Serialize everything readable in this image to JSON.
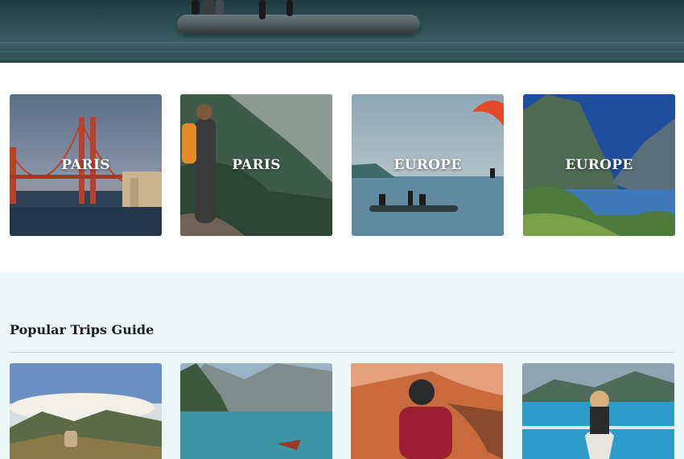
{
  "hero": {
    "image": "lake-platform-photo"
  },
  "destinations": [
    {
      "label": "PARIS",
      "image": "golden-gate-bridge-photo"
    },
    {
      "label": "PARIS",
      "image": "hiker-mountain-photo"
    },
    {
      "label": "EUROPE",
      "image": "lake-platform-paraglider-photo"
    },
    {
      "label": "EUROPE",
      "image": "fjord-mountains-photo"
    }
  ],
  "popular": {
    "title": "Popular Trips Guide",
    "cards": [
      {
        "image": "mountain-dog-photo"
      },
      {
        "image": "alpine-lake-boat-photo"
      },
      {
        "image": "canyon-traveler-photo"
      },
      {
        "image": "kayaker-lake-photo"
      }
    ]
  }
}
